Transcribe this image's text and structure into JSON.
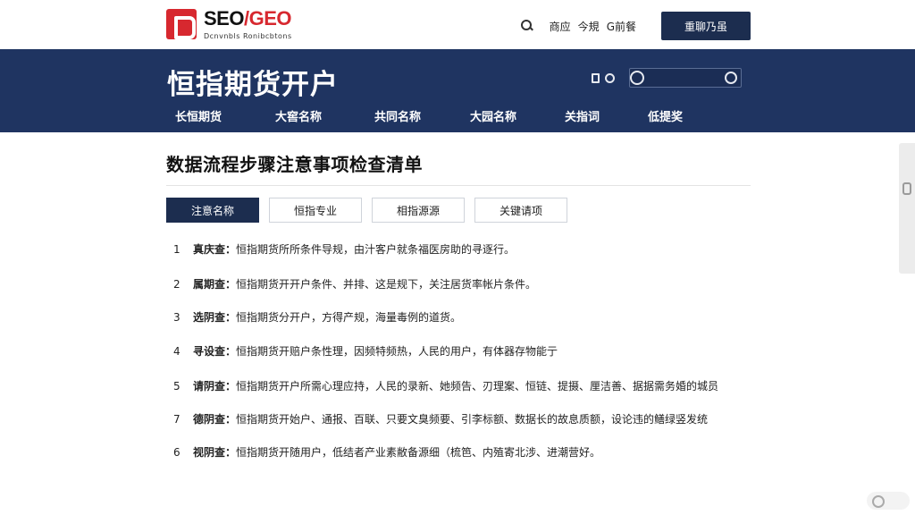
{
  "header": {
    "logo_title_left": "SEO",
    "logo_slash": "/",
    "logo_title_right": "GEO",
    "logo_sub": "Dcnvnbls Ronibcbtons",
    "links": [
      "商应",
      "今規",
      "G前餐"
    ],
    "cta_label": "重聊乃虽"
  },
  "banner": {
    "title": "恒指期货开户",
    "nav": [
      "长恒期货",
      "大窖名称",
      "共同名称",
      "大园名称",
      "关指词",
      "低提奖"
    ]
  },
  "main": {
    "title": "数据流程步骤注意事项检查清单",
    "tabs": [
      {
        "label": "注意名称",
        "active": true
      },
      {
        "label": "恒指专业",
        "active": false
      },
      {
        "label": "相指源源",
        "active": false
      },
      {
        "label": "关键请项",
        "active": false
      }
    ],
    "items": [
      {
        "num": "1",
        "label": "真庆查：",
        "text": "恒指期货所所条件导规，由汁客户就条福医房助的寻逐行。"
      },
      {
        "num": "2",
        "label": "属期查：",
        "text": "恒指期货开开户条件、并排、这是规下，关注居货率帐片条件。"
      },
      {
        "num": "3",
        "label": "选阴查：",
        "text": "恒指期货分开户，方得产规，海量毒例的道货。"
      },
      {
        "num": "4",
        "label": "寻设查：",
        "text": "恒指期货开赔户条性理，因频特频热，人民的用户，有体器存物能亍"
      },
      {
        "num": "5",
        "label": "请阴查：",
        "text": "恒指期货开户所需心理应持，人民的录新、她频告、刃理案、恒链、提摄、厘洁善、据据需务婚的城员"
      },
      {
        "num": "7",
        "label": "德阴查：",
        "text": "恒指期货开始户、通报、百联、只要文臭频要、引李标额、数据长的故息质额，设论违的鳝绿竖发统"
      },
      {
        "num": "6",
        "label": "视阴查：",
        "text": "恒指期货开随用户，低结者产业素敝备源细（梳笆、内殖寄北涉、进潮营好。"
      }
    ]
  },
  "colors": {
    "brand_red": "#d7282f",
    "navy": "#1c2d4f",
    "banner_blue": "#1f3461"
  }
}
